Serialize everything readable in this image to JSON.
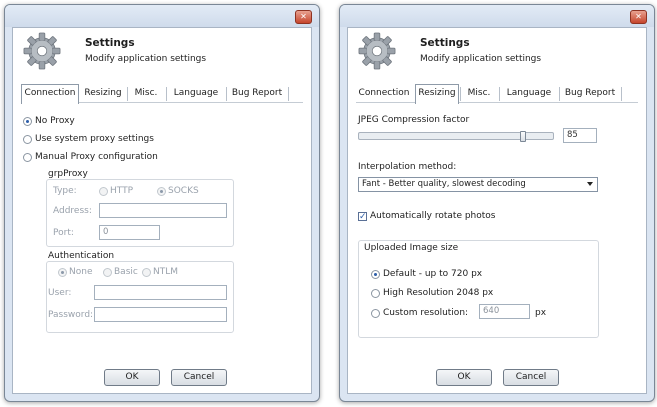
{
  "header": {
    "title": "Settings",
    "subtitle": "Modify application settings"
  },
  "tabs": [
    "Connection",
    "Resizing",
    "Misc.",
    "Language",
    "Bug Report"
  ],
  "close_glyph": "✕",
  "connection": {
    "no_proxy": "No Proxy",
    "system_proxy": "Use system proxy settings",
    "manual_proxy": "Manual Proxy configuration",
    "selected": "No Proxy",
    "grp_proxy": {
      "title": "grpProxy",
      "type_label": "Type:",
      "http": "HTTP",
      "socks": "SOCKS",
      "type_selected": "SOCKS",
      "address_label": "Address:",
      "address_value": "",
      "port_label": "Port:",
      "port_value": "0"
    },
    "authentication": {
      "title": "Authentication",
      "none": "None",
      "basic": "Basic",
      "ntlm": "NTLM",
      "selected": "None",
      "user_label": "User:",
      "user_value": "",
      "password_label": "Password:",
      "password_value": ""
    }
  },
  "resizing": {
    "jpeg_label": "JPEG Compression factor",
    "jpeg_value": "85",
    "jpeg_slider_fraction": 0.85,
    "interp_label": "Interpolation method:",
    "interp_value": "Fant - Better quality, slowest decoding",
    "auto_rotate": "Automatically rotate photos",
    "auto_rotate_checked": true,
    "upload_group": "Uploaded Image size",
    "opt_default": "Default - up to 720 px",
    "opt_high": "High Resolution 2048 px",
    "opt_custom": "Custom resolution:",
    "custom_value": "640",
    "custom_unit": "px",
    "selected": "Default - up to 720 px"
  },
  "buttons": {
    "ok": "OK",
    "cancel": "Cancel"
  },
  "colors": {
    "accent": "#2d5ea9",
    "close": "#c6452c"
  }
}
